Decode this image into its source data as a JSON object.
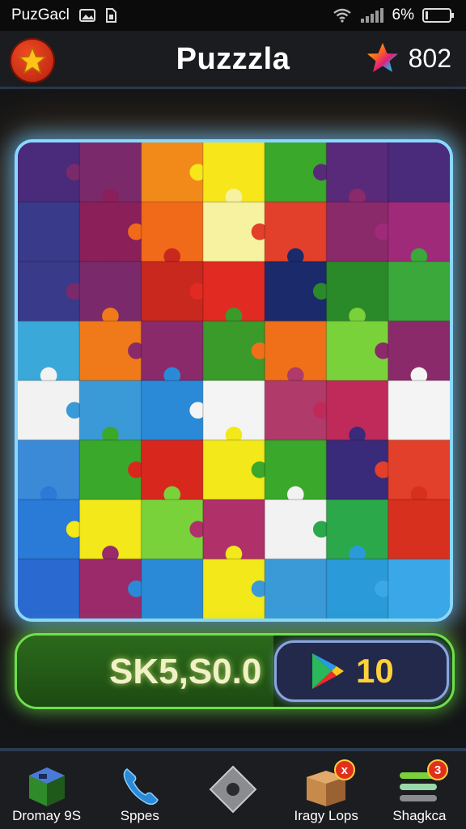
{
  "status_bar": {
    "app_name": "PuzGacl",
    "battery": "6%",
    "icons": [
      "photo-icon",
      "sim-icon",
      "wifi-icon",
      "signal-icon",
      "battery-icon"
    ]
  },
  "header": {
    "title": "Puzzzla",
    "score": "802",
    "left_icon": "star-icon",
    "right_icon": "rainbow-star-icon"
  },
  "board": {
    "rows": 8,
    "cols": 7,
    "pieces": [
      [
        "#4a2a7a",
        "#7a2a6a",
        "#f28a1a",
        "#f7e61a",
        "#3aa82a",
        "#5a2a7a",
        "#4a2a7a"
      ],
      [
        "#3a3a8a",
        "#8a1f5a",
        "#f06a1a",
        "#f7f2a0",
        "#e2402a",
        "#8a2a6a",
        "#a02a7a"
      ],
      [
        "#3a3a8a",
        "#7a2a6a",
        "#c8281e",
        "#e12a22",
        "#1a2a6a",
        "#2a8a2a",
        "#3aa83a"
      ],
      [
        "#3aa8d8",
        "#f07a1a",
        "#8a2a6a",
        "#3a9a2a",
        "#f0701a",
        "#7ad23a",
        "#8a2a6a"
      ],
      [
        "#f2f2f2",
        "#3a9ad8",
        "#2a8ad8",
        "#f4f4f4",
        "#b03a6a",
        "#c02a5a",
        "#f4f4f4"
      ],
      [
        "#3a8ad8",
        "#3aa82a",
        "#d8281e",
        "#f2e81a",
        "#3aa82a",
        "#3a2a7a",
        "#e2402a"
      ],
      [
        "#2a7ad8",
        "#f2e81a",
        "#7ad23a",
        "#b0306a",
        "#f2f2f2",
        "#2aa84a",
        "#d8301e"
      ],
      [
        "#2a6ad0",
        "#9a2a6a",
        "#2a8ad8",
        "#f2e81a",
        "#3a9ad8",
        "#2a9ad8",
        "#3aa8e8"
      ]
    ]
  },
  "progress": {
    "coins": "SK5,S0.0",
    "fill": 0.59,
    "play_count": "10",
    "play_icon": "play-store-icon"
  },
  "bottom_nav": {
    "items": [
      {
        "label": "Dromay 9S",
        "icon": "cube-icon",
        "badge": ""
      },
      {
        "label": "Sppes",
        "icon": "phone-icon",
        "badge": ""
      },
      {
        "label": "",
        "icon": "diamond-icon",
        "badge": ""
      },
      {
        "label": "Iragy Lops",
        "icon": "box-icon",
        "badge": "x"
      },
      {
        "label": "Shagkca",
        "icon": "layers-icon",
        "badge": "3"
      }
    ]
  },
  "colors": {
    "frame_glow": "#8ad7ff",
    "progress_glow": "#6fe04a",
    "play_count": "#ffd23a",
    "star_button": "#e0301c"
  }
}
